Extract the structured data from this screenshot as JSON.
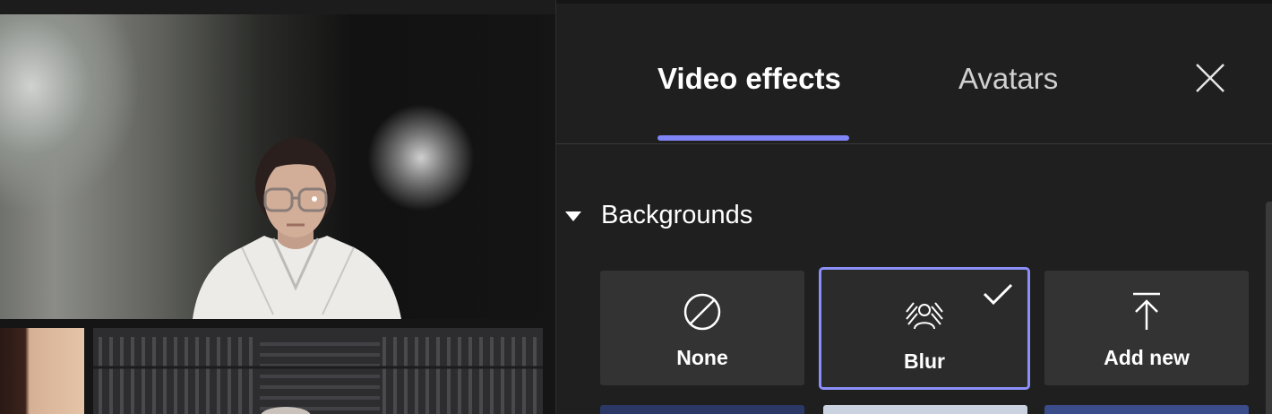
{
  "tabs": [
    {
      "label": "Video effects",
      "active": true
    },
    {
      "label": "Avatars",
      "active": false
    }
  ],
  "section": {
    "title": "Backgrounds",
    "expanded": true
  },
  "backgrounds": [
    {
      "label": "None",
      "icon": "none-icon",
      "selected": false
    },
    {
      "label": "Blur",
      "icon": "blur-icon",
      "selected": true
    },
    {
      "label": "Add new",
      "icon": "upload-icon",
      "selected": false
    }
  ],
  "colors": {
    "accent": "#7f85f5",
    "selected_border": "#8b8ff7",
    "panel_bg": "#1f1f1f",
    "card_bg": "#333333"
  }
}
